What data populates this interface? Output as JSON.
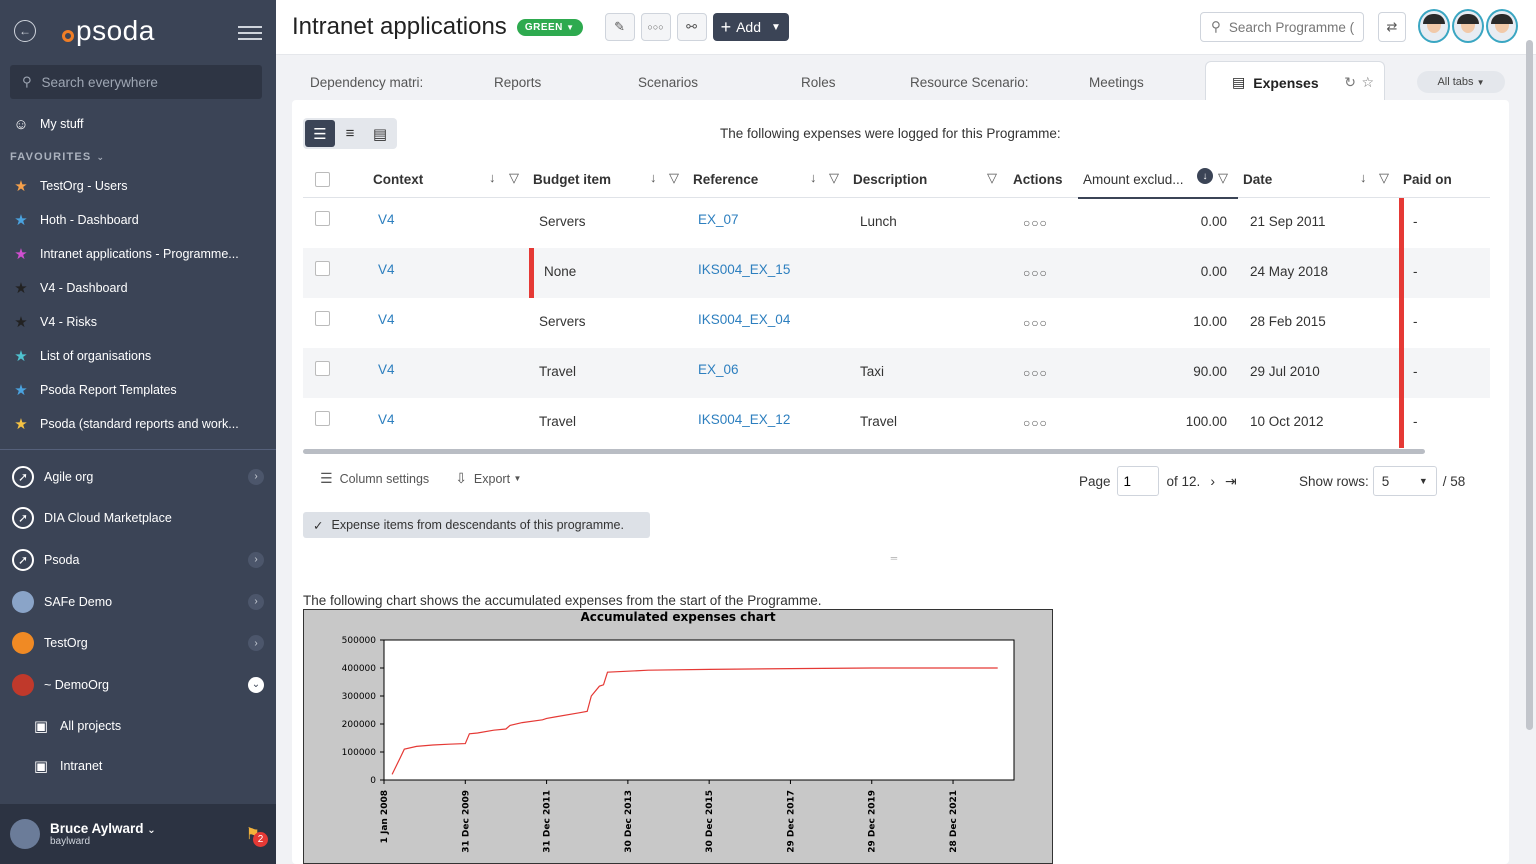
{
  "sidebar": {
    "search_placeholder": "Search everywhere",
    "logo": "psoda",
    "my_stuff": "My stuff",
    "favourites_heading": "FAVOURITES",
    "favourites": [
      {
        "label": "TestOrg - Users",
        "star_color": "#f6a14b"
      },
      {
        "label": "Hoth - Dashboard",
        "star_color": "#4aa3df"
      },
      {
        "label": "Intranet applications - Programme...",
        "star_color": "#d04fd0"
      },
      {
        "label": "V4 - Dashboard",
        "star_color": "#222222"
      },
      {
        "label": "V4 - Risks",
        "star_color": "#222222"
      },
      {
        "label": "List of organisations",
        "star_color": "#4fc3d0"
      },
      {
        "label": "Psoda Report Templates",
        "star_color": "#4aa3df"
      },
      {
        "label": "Psoda (standard reports and work...",
        "star_color": "#f6c343"
      }
    ],
    "orgs": [
      {
        "label": "Agile org",
        "icon": "compass-icon",
        "expand": "collapsed"
      },
      {
        "label": "DIA Cloud Marketplace",
        "icon": "compass-icon",
        "expand": "none"
      },
      {
        "label": "Psoda",
        "icon": "compass-icon",
        "expand": "collapsed"
      },
      {
        "label": "SAFe Demo",
        "icon": "safe-logo-icon",
        "expand": "collapsed"
      },
      {
        "label": "TestOrg",
        "icon": "testorg-logo-icon",
        "expand": "collapsed"
      },
      {
        "label": "~ DemoOrg",
        "icon": "demoorg-logo-icon",
        "expand": "expanded"
      }
    ],
    "sub_items": [
      {
        "label": "All projects"
      },
      {
        "label": "Intranet"
      }
    ],
    "user": {
      "name": "Bruce Aylward",
      "username": "baylward",
      "notifications": "2"
    }
  },
  "header": {
    "title": "Intranet applications",
    "status": "GREEN",
    "add_label": "Add",
    "search_placeholder": "Search Programme (",
    "accent": "#3b4456"
  },
  "tabs": {
    "items": [
      "Dependency matri:",
      "Reports",
      "Scenarios",
      "Roles",
      "Resource Scenario:",
      "Meetings"
    ],
    "active": "Expenses",
    "all_tabs": "All tabs"
  },
  "main": {
    "intro": "The following expenses were logged for this Programme:",
    "columns": [
      "Context",
      "Budget item",
      "Reference",
      "Description",
      "Actions",
      "Amount exclud...",
      "Date",
      "Paid on"
    ],
    "rows": [
      {
        "context": "V4",
        "budget_item": "Servers",
        "reference": "EX_07",
        "description": "Lunch",
        "amount": "0.00",
        "date": "21 Sep 2011",
        "paid_on": "-"
      },
      {
        "context": "V4",
        "budget_item": "None",
        "reference": "IKS004_EX_15",
        "description": "",
        "amount": "0.00",
        "date": "24 May 2018",
        "paid_on": "-"
      },
      {
        "context": "V4",
        "budget_item": "Servers",
        "reference": "IKS004_EX_04",
        "description": "",
        "amount": "10.00",
        "date": "28 Feb 2015",
        "paid_on": "-"
      },
      {
        "context": "V4",
        "budget_item": "Travel",
        "reference": "EX_06",
        "description": "Taxi",
        "amount": "90.00",
        "date": "29 Jul 2010",
        "paid_on": "-"
      },
      {
        "context": "V4",
        "budget_item": "Travel",
        "reference": "IKS004_EX_12",
        "description": "Travel",
        "amount": "100.00",
        "date": "10 Oct 2012",
        "paid_on": "-"
      }
    ],
    "column_settings": "Column settings",
    "export": "Export",
    "page_label": "Page",
    "page_value": "1",
    "page_of": "of 12.",
    "show_rows_label": "Show rows:",
    "show_rows_value": "5",
    "total": "/ 58",
    "filter_chip": "Expense items from descendants of this programme.",
    "chart_caption": "The following chart shows the accumulated expenses from the start of the Programme."
  },
  "chart_data": {
    "type": "line",
    "title": "Accumulated expenses chart",
    "xlabel": "",
    "ylabel": "",
    "x_tick_labels": [
      "1 Jan 2008",
      "31 Dec 2009",
      "31 Dec 2011",
      "30 Dec 2013",
      "30 Dec 2015",
      "29 Dec 2017",
      "29 Dec 2019",
      "28 Dec 2021"
    ],
    "y_tick_labels": [
      "0",
      "100000",
      "200000",
      "300000",
      "400000",
      "500000"
    ],
    "ylim": [
      0,
      500000
    ],
    "xlim": [
      2008.0,
      2023.5
    ],
    "line_color": "#e53935",
    "series": [
      {
        "x": [
          2008.2,
          2008.4,
          2008.5,
          2008.8,
          2009.2,
          2009.6,
          2010.0,
          2010.1,
          2010.3,
          2010.7,
          2011.0,
          2011.1,
          2011.4,
          2011.9,
          2012.0,
          2012.2,
          2012.8,
          2013.0,
          2013.1,
          2013.3,
          2013.4,
          2013.5,
          2014.5,
          2016.0,
          2018.0,
          2020.0,
          2022.0,
          2023.1
        ],
        "y": [
          20000,
          80000,
          110000,
          120000,
          125000,
          128000,
          130000,
          165000,
          168000,
          178000,
          182000,
          195000,
          205000,
          215000,
          220000,
          225000,
          240000,
          245000,
          300000,
          335000,
          340000,
          385000,
          392000,
          395000,
          398000,
          400000,
          400000,
          400000
        ]
      }
    ],
    "grid": false
  }
}
